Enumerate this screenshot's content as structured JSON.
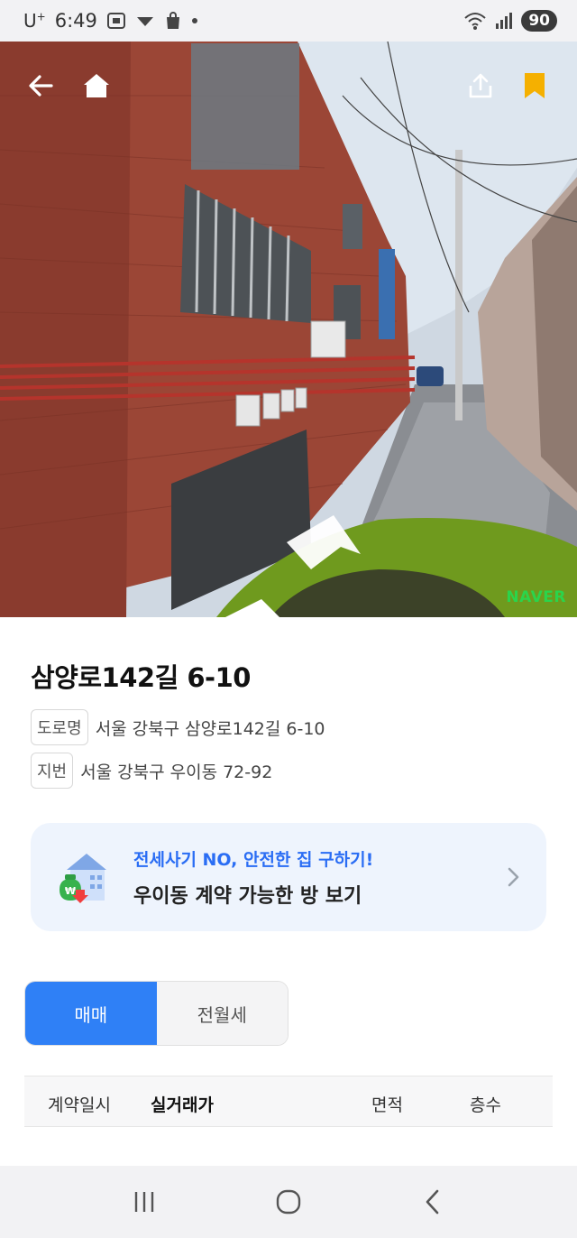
{
  "status_bar": {
    "carrier": "U",
    "carrier_sup": "+",
    "time": "6:49",
    "battery": "90",
    "icons": [
      "screenshot-icon",
      "download-icon",
      "shopping-bag-icon",
      "dot-icon",
      "wifi-icon",
      "signal-icon"
    ]
  },
  "hero": {
    "watermark": "NAVER",
    "buttons": [
      "back-arrow-icon",
      "home-icon",
      "share-icon",
      "bookmark-icon"
    ],
    "bookmark_color": "#f5b000"
  },
  "property": {
    "title": "삼양로142길 6-10",
    "road_tag": "도로명",
    "road_address": "서울 강북구 삼양로142길 6-10",
    "lot_tag": "지번",
    "lot_address": "서울 강북구 우이동 72-92"
  },
  "banner": {
    "line1": "전세사기 NO, 안전한 집 구하기!",
    "line2": "우이동 계약 가능한 방 보기",
    "accent": "#2a6df4"
  },
  "tabs": [
    {
      "label": "매매",
      "active": true
    },
    {
      "label": "전월세",
      "active": false
    }
  ],
  "table": {
    "headers": [
      "계약일시",
      "실거래가",
      "면적",
      "층수"
    ]
  },
  "nav_bar": {
    "buttons": [
      "recent-apps-icon",
      "home-circle-icon",
      "back-chevron-icon"
    ]
  }
}
